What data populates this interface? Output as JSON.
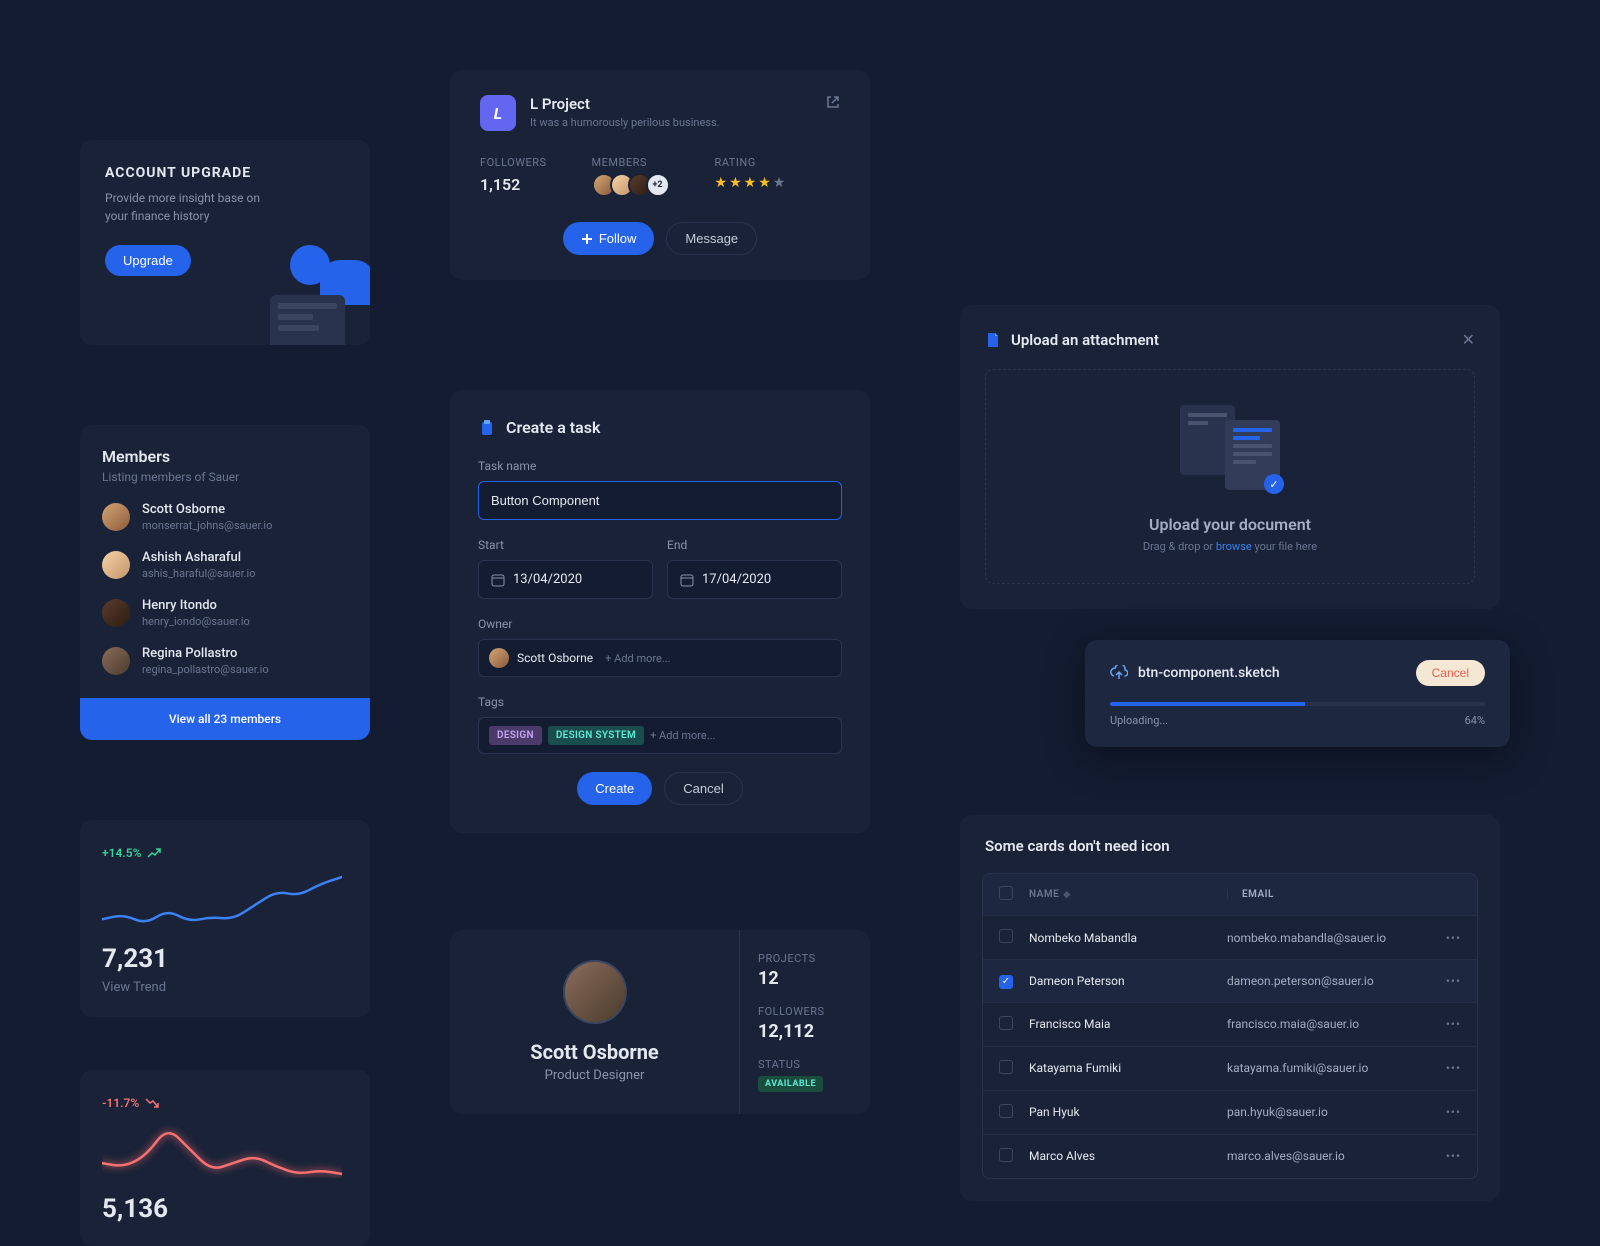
{
  "account_upgrade": {
    "title": "ACCOUNT UPGRADE",
    "description": "Provide more insight base on your finance history",
    "button": "Upgrade"
  },
  "members": {
    "title": "Members",
    "subtitle": "Listing members of Sauer",
    "list": [
      {
        "name": "Scott Osborne",
        "email": "monserrat_johns@sauer.io"
      },
      {
        "name": "Ashish Asharaful",
        "email": "ashis_haraful@sauer.io"
      },
      {
        "name": "Henry Itondo",
        "email": "henry_iondo@sauer.io"
      },
      {
        "name": "Regina Pollastro",
        "email": "regina_pollastro@sauer.io"
      }
    ],
    "view_all": "View all 23 members"
  },
  "trend1": {
    "pct": "+14.5%",
    "value": "7,231",
    "cta": "View Trend"
  },
  "trend2": {
    "pct": "-11.7%",
    "value": "5,136"
  },
  "chart_data": [
    {
      "type": "line",
      "title": "trend-up",
      "values": [
        18,
        20,
        16,
        22,
        17,
        19,
        18,
        24,
        30,
        28,
        33,
        36
      ],
      "color": "#3b82f6"
    },
    {
      "type": "line",
      "title": "trend-down",
      "values": [
        20,
        19,
        22,
        30,
        24,
        18,
        20,
        22,
        19,
        17,
        18,
        17
      ],
      "color": "#f87171"
    }
  ],
  "lproject": {
    "title": "L Project",
    "desc": "It was a humorously perilous business.",
    "followers_label": "FOLLOWERS",
    "followers": "1,152",
    "members_label": "MEMBERS",
    "members_more": "+2",
    "rating_label": "RATING",
    "follow": "Follow",
    "message": "Message"
  },
  "create_task": {
    "title": "Create a task",
    "task_name_label": "Task name",
    "task_name_value": "Button Component",
    "start_label": "Start",
    "start_value": "13/04/2020",
    "end_label": "End",
    "end_value": "17/04/2020",
    "owner_label": "Owner",
    "owner_value": "Scott Osborne",
    "add_more": "+ Add more...",
    "tags_label": "Tags",
    "tag1": "DESIGN",
    "tag2": "DESIGN SYSTEM",
    "create": "Create",
    "cancel": "Cancel"
  },
  "profile": {
    "name": "Scott Osborne",
    "role": "Product Designer",
    "projects_label": "PROJECTS",
    "projects": "12",
    "followers_label": "FOLLOWERS",
    "followers": "12,112",
    "status_label": "STATUS",
    "status": "AVAILABLE"
  },
  "upload": {
    "title": "Upload an attachment",
    "headline": "Upload your document",
    "sub_a": "Drag & drop or ",
    "sub_link": "browse",
    "sub_b": " your file here"
  },
  "uploading": {
    "filename": "btn-component.sketch",
    "cancel": "Cancel",
    "status": "Uploading...",
    "pct": "64%",
    "progress": 52
  },
  "table": {
    "title": "Some cards don't need icon",
    "col_name": "NAME",
    "col_email": "EMAIL",
    "rows": [
      {
        "name": "Nombeko Mabandla",
        "email": "nombeko.mabandla@sauer.io",
        "checked": false
      },
      {
        "name": "Dameon Peterson",
        "email": "dameon.peterson@sauer.io",
        "checked": true
      },
      {
        "name": "Francisco Maia",
        "email": "francisco.maia@sauer.io",
        "checked": false
      },
      {
        "name": "Katayama Fumiki",
        "email": "katayama.fumiki@sauer.io",
        "checked": false
      },
      {
        "name": "Pan Hyuk",
        "email": "pan.hyuk@sauer.io",
        "checked": false
      },
      {
        "name": "Marco Alves",
        "email": "marco.alves@sauer.io",
        "checked": false
      }
    ]
  }
}
